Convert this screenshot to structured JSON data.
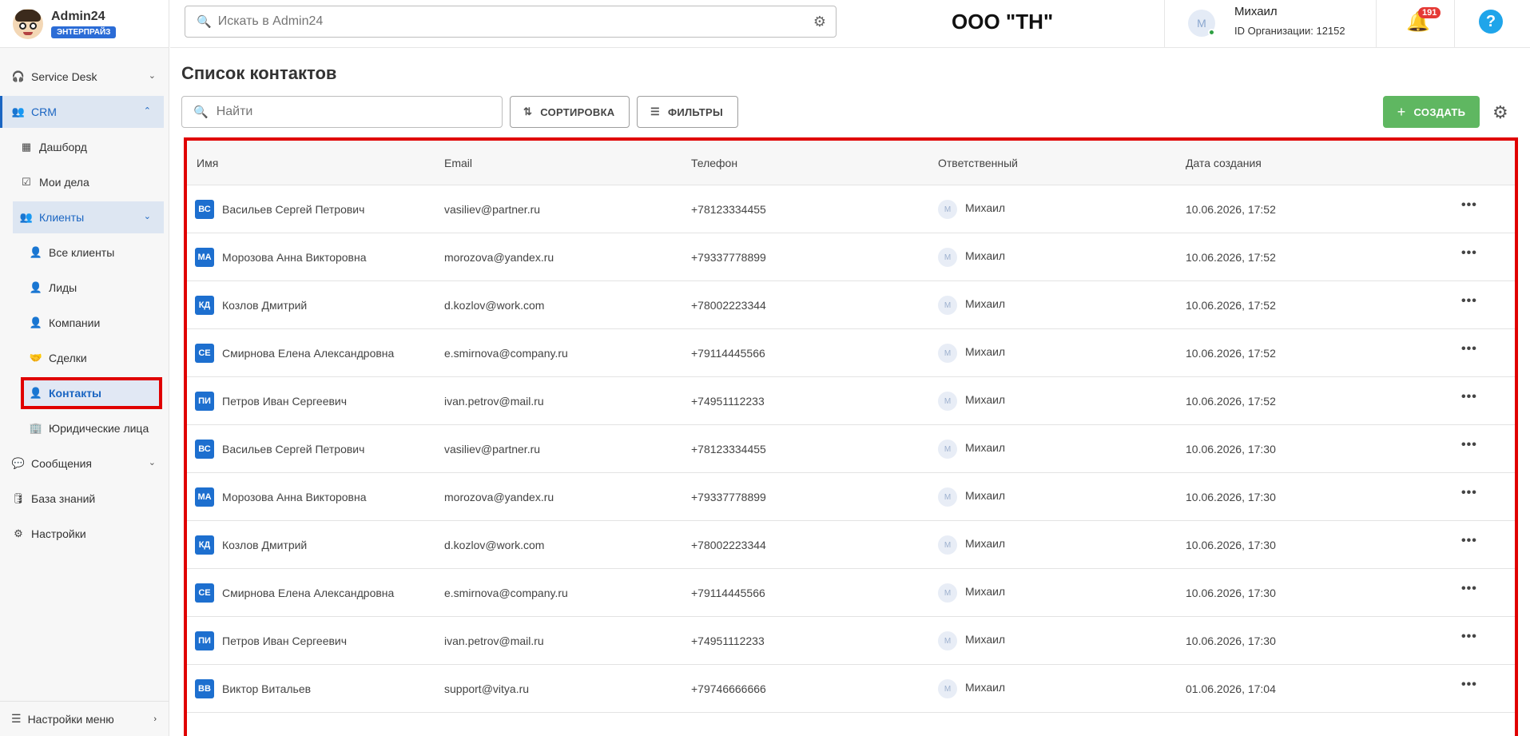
{
  "brand": {
    "name": "Admin24",
    "badge": "ЭНТЕРПРАЙЗ"
  },
  "header": {
    "search_placeholder": "Искать в Admin24",
    "org_name": "ООО \"ТН\"",
    "user": {
      "initial": "М",
      "name": "Михаил",
      "org_id": "ID Организации: 12152"
    },
    "notifications_count": "191",
    "help": "?"
  },
  "sidebar": {
    "service_desk": "Service Desk",
    "crm": "CRM",
    "dashboard": "Дашборд",
    "my_tasks": "Мои дела",
    "clients": "Клиенты",
    "all_clients": "Все клиенты",
    "leads": "Лиды",
    "companies": "Компании",
    "deals": "Сделки",
    "contacts": "Контакты",
    "legal_entities": "Юридические лица",
    "messages": "Сообщения",
    "knowledge_base": "База знаний",
    "settings": "Настройки",
    "menu_settings": "Настройки меню"
  },
  "main": {
    "title": "Список контактов",
    "search_placeholder": "Найти",
    "sort_label": "СОРТИРОВКА",
    "filter_label": "ФИЛЬТРЫ",
    "create_label": "СОЗДАТЬ"
  },
  "table": {
    "columns": {
      "name": "Имя",
      "email": "Email",
      "phone": "Телефон",
      "responsible": "Ответственный",
      "created": "Дата создания"
    },
    "rows": [
      {
        "initials": "ВС",
        "name": "Васильев Сергей Петрович",
        "email": "vasiliev@partner.ru",
        "phone": "+78123334455",
        "responsible_initial": "М",
        "responsible": "Михаил",
        "created": "10.06.2026, 17:52"
      },
      {
        "initials": "МА",
        "name": "Морозова Анна Викторовна",
        "email": "morozova@yandex.ru",
        "phone": "+79337778899",
        "responsible_initial": "М",
        "responsible": "Михаил",
        "created": "10.06.2026, 17:52"
      },
      {
        "initials": "КД",
        "name": "Козлов Дмитрий",
        "email": "d.kozlov@work.com",
        "phone": "+78002223344",
        "responsible_initial": "М",
        "responsible": "Михаил",
        "created": "10.06.2026, 17:52"
      },
      {
        "initials": "СЕ",
        "name": "Смирнова Елена Александровна",
        "email": "e.smirnova@company.ru",
        "phone": "+79114445566",
        "responsible_initial": "М",
        "responsible": "Михаил",
        "created": "10.06.2026, 17:52"
      },
      {
        "initials": "ПИ",
        "name": "Петров Иван Сергеевич",
        "email": "ivan.petrov@mail.ru",
        "phone": "+74951112233",
        "responsible_initial": "М",
        "responsible": "Михаил",
        "created": "10.06.2026, 17:52"
      },
      {
        "initials": "ВС",
        "name": "Васильев Сергей Петрович",
        "email": "vasiliev@partner.ru",
        "phone": "+78123334455",
        "responsible_initial": "М",
        "responsible": "Михаил",
        "created": "10.06.2026, 17:30"
      },
      {
        "initials": "МА",
        "name": "Морозова Анна Викторовна",
        "email": "morozova@yandex.ru",
        "phone": "+79337778899",
        "responsible_initial": "М",
        "responsible": "Михаил",
        "created": "10.06.2026, 17:30"
      },
      {
        "initials": "КД",
        "name": "Козлов Дмитрий",
        "email": "d.kozlov@work.com",
        "phone": "+78002223344",
        "responsible_initial": "М",
        "responsible": "Михаил",
        "created": "10.06.2026, 17:30"
      },
      {
        "initials": "СЕ",
        "name": "Смирнова Елена Александровна",
        "email": "e.smirnova@company.ru",
        "phone": "+79114445566",
        "responsible_initial": "М",
        "responsible": "Михаил",
        "created": "10.06.2026, 17:30"
      },
      {
        "initials": "ПИ",
        "name": "Петров Иван Сергеевич",
        "email": "ivan.petrov@mail.ru",
        "phone": "+74951112233",
        "responsible_initial": "М",
        "responsible": "Михаил",
        "created": "10.06.2026, 17:30"
      },
      {
        "initials": "ВВ",
        "name": "Виктор Витальев",
        "email": "support@vitya.ru",
        "phone": "+79746666666",
        "responsible_initial": "М",
        "responsible": "Михаил",
        "created": "01.06.2026, 17:04"
      }
    ]
  },
  "colors": {
    "accent": "#1a65c2",
    "create_button": "#5fb761",
    "highlight_outline": "#e00000",
    "notification_badge": "#e53935"
  }
}
